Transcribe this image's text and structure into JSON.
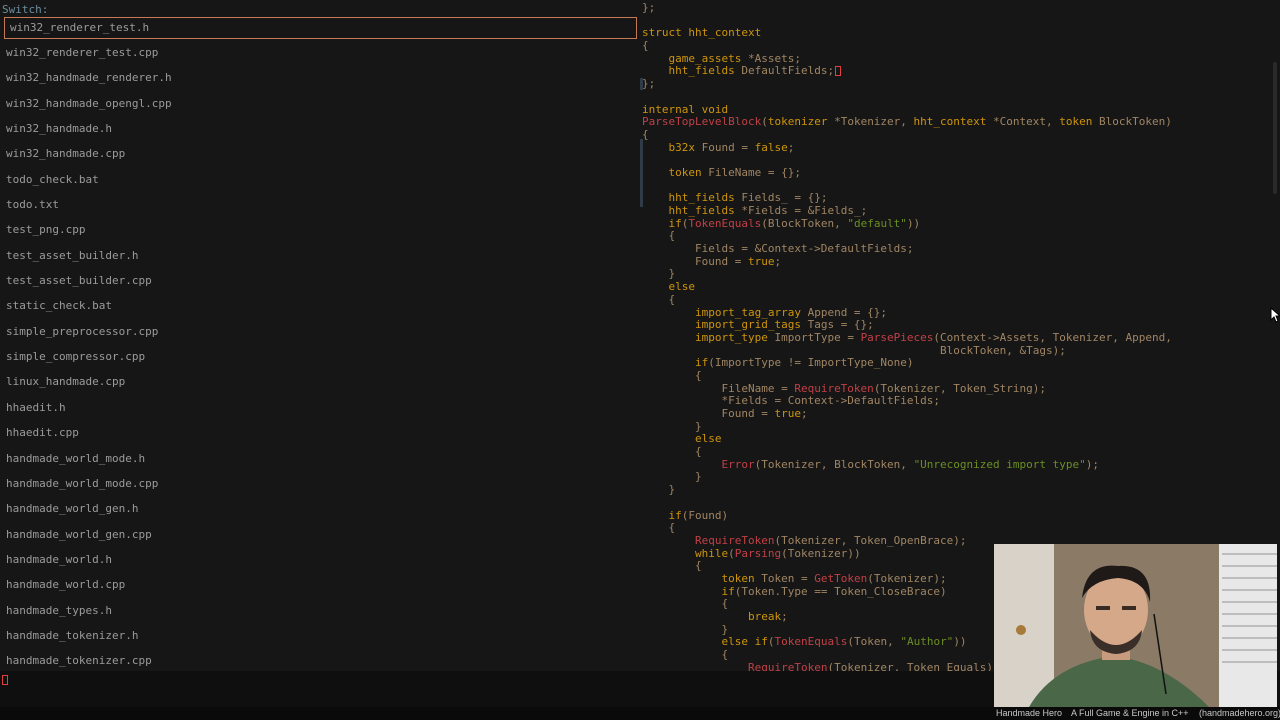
{
  "switch_panel": {
    "label": "Switch:",
    "files": [
      "win32_renderer_test.h",
      "win32_renderer_test.cpp",
      "win32_handmade_renderer.h",
      "win32_handmade_opengl.cpp",
      "win32_handmade.h",
      "win32_handmade.cpp",
      "todo_check.bat",
      "todo.txt",
      "test_png.cpp",
      "test_asset_builder.h",
      "test_asset_builder.cpp",
      "static_check.bat",
      "simple_preprocessor.cpp",
      "simple_compressor.cpp",
      "linux_handmade.cpp",
      "hhaedit.h",
      "hhaedit.cpp",
      "handmade_world_mode.h",
      "handmade_world_mode.cpp",
      "handmade_world_gen.h",
      "handmade_world_gen.cpp",
      "handmade_world.h",
      "handmade_world.cpp",
      "handmade_types.h",
      "handmade_tokenizer.h",
      "handmade_tokenizer.cpp"
    ],
    "selected_index": 0
  },
  "code_lines": [
    "};",
    "",
    "struct hht_context",
    "{",
    "    game_assets *Assets;",
    "    hht_fields DefaultFields;",
    "};",
    "",
    "internal void",
    "ParseTopLevelBlock(tokenizer *Tokenizer, hht_context *Context, token BlockToken)",
    "{",
    "    b32x Found = false;",
    "",
    "    token FileName = {};",
    "",
    "    hht_fields Fields_ = {};",
    "    hht_fields *Fields = &Fields_;",
    "    if(TokenEquals(BlockToken, \"default\"))",
    "    {",
    "        Fields = &Context->DefaultFields;",
    "        Found = true;",
    "    }",
    "    else",
    "    {",
    "        import_tag_array Append = {};",
    "        import_grid_tags Tags = {};",
    "        import_type ImportType = ParsePieces(Context->Assets, Tokenizer, Append,",
    "                                             BlockToken, &Tags);",
    "        if(ImportType != ImportType_None)",
    "        {",
    "            FileName = RequireToken(Tokenizer, Token_String);",
    "            *Fields = Context->DefaultFields;",
    "            Found = true;",
    "        }",
    "        else",
    "        {",
    "            Error(Tokenizer, BlockToken, \"Unrecognized import type\");",
    "        }",
    "    }",
    "",
    "    if(Found)",
    "    {",
    "        RequireToken(Tokenizer, Token_OpenBrace);",
    "        while(Parsing(Tokenizer))",
    "        {",
    "            token Token = GetToken(Tokenizer);",
    "            if(Token.Type == Token_CloseBrace)",
    "            {",
    "                break;",
    "            }",
    "            else if(TokenEquals(Token, \"Author\"))",
    "            {",
    "                RequireToken(Tokenizer, Token_Equals);"
  ],
  "bottom_bar": {
    "show": "Handmade Hero",
    "tagline": "A Full Game & Engine in C++",
    "url": "(handmadehero.org)"
  },
  "colors": {
    "background": "#161616",
    "keyword": "#cd950c",
    "function": "#c04047",
    "string": "#6b8e23",
    "selection_border": "#c57a55"
  }
}
